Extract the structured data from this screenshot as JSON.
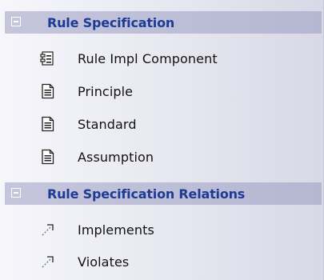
{
  "toolbox": {
    "sections": [
      {
        "title": "Rule Specification",
        "items": [
          {
            "label": "Rule Impl Component",
            "icon": "component-icon"
          },
          {
            "label": "Principle",
            "icon": "document-icon"
          },
          {
            "label": "Standard",
            "icon": "document-icon"
          },
          {
            "label": "Assumption",
            "icon": "document-icon"
          }
        ]
      },
      {
        "title": "Rule Specification Relations",
        "items": [
          {
            "label": "Implements",
            "icon": "dashed-arrow-icon"
          },
          {
            "label": "Violates",
            "icon": "dashed-arrow-icon"
          }
        ]
      }
    ]
  },
  "colors": {
    "header_text": "#1d3b95",
    "header_bg": "#b5b7d2",
    "panel_bg": "#e7e7f1"
  }
}
